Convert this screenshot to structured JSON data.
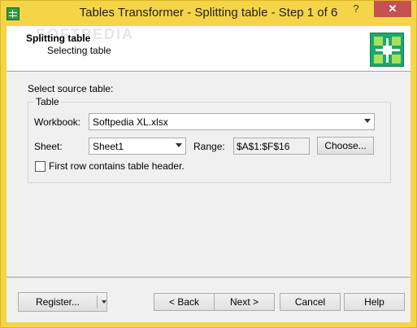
{
  "window": {
    "title": "Tables Transformer - Splitting table - Step 1 of 6",
    "help_label": "?",
    "close_label": "✕"
  },
  "header": {
    "title": "Splitting table",
    "subtitle": "Selecting table",
    "watermark": "SOFTPEDIA"
  },
  "form": {
    "prompt": "Select source table:",
    "group_title": "Table",
    "workbook_label": "Workbook:",
    "workbook_value": "Softpedia XL.xlsx",
    "sheet_label": "Sheet:",
    "sheet_value": "Sheet1",
    "range_label": "Range:",
    "range_value": "$A$1:$F$16",
    "choose_label": "Choose...",
    "checkbox_label": "First row contains table header.",
    "checkbox_checked": false
  },
  "footer": {
    "register_label": "Register...",
    "back_label": "< Back",
    "next_label": "Next >",
    "cancel_label": "Cancel",
    "help_label": "Help"
  }
}
